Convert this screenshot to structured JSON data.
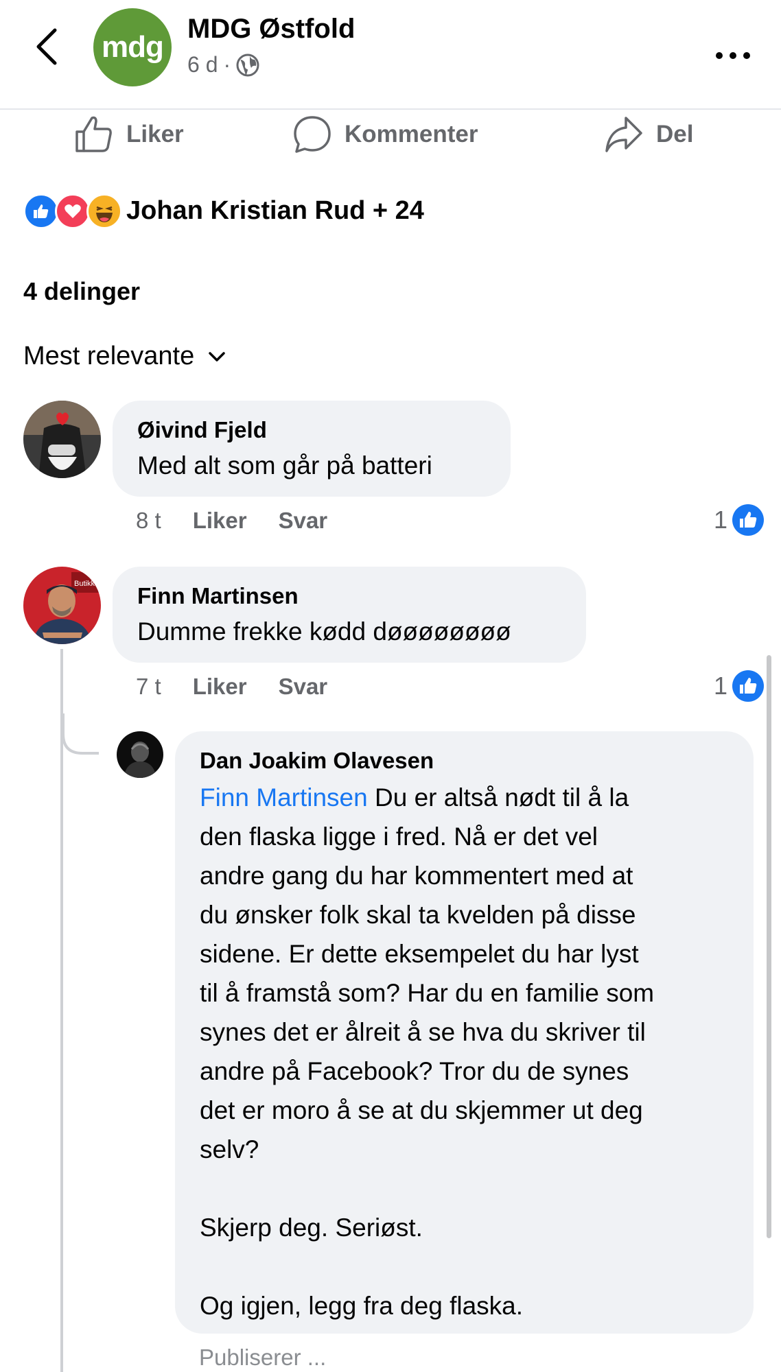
{
  "header": {
    "page_name": "MDG Østfold",
    "logo_text": "mdg",
    "time": "6 d",
    "separator": "·",
    "privacy_icon": "globe-icon"
  },
  "actions": {
    "like": "Liker",
    "comment": "Kommenter",
    "share": "Del"
  },
  "reactions": {
    "icons": [
      "like-icon",
      "love-icon",
      "haha-icon"
    ],
    "text": "Johan Kristian Rud + 24"
  },
  "shares": "4 delinger",
  "sort": {
    "label": "Mest relevante"
  },
  "comments": [
    {
      "author": "Øivind Fjeld",
      "text": "Med alt som går på batteri",
      "time": "8 t",
      "like_label": "Liker",
      "reply_label": "Svar",
      "likes": "1"
    },
    {
      "author": "Finn Martinsen",
      "text": "Dumme frekke kødd døøøøøøøø",
      "time": "7 t",
      "like_label": "Liker",
      "reply_label": "Svar",
      "likes": "1",
      "replies": [
        {
          "author": "Dan Joakim Olavesen",
          "mention": "Finn Martinsen",
          "lines": [
            " Du er altså nødt til å la",
            "den flaska ligge i fred. Nå er det vel",
            "andre gang du har kommentert med at",
            "du ønsker folk skal ta kvelden på disse",
            "sidene. Er dette eksempelet du har lyst",
            "til å framstå som? Har du en familie som",
            "synes det er ålreit å se hva du skriver til",
            "andre på Facebook? Tror du de synes",
            "det er moro å se at du skjemmer ut deg",
            "selv?",
            "",
            "Skjerp deg. Seriøst.",
            "",
            "Og igjen, legg fra deg flaska."
          ],
          "status": "Publiserer ..."
        }
      ]
    }
  ],
  "colors": {
    "brand_green": "#5f9a38",
    "facebook_blue": "#1877f2",
    "bubble_bg": "#f0f2f5",
    "secondary_text": "#65676b"
  }
}
